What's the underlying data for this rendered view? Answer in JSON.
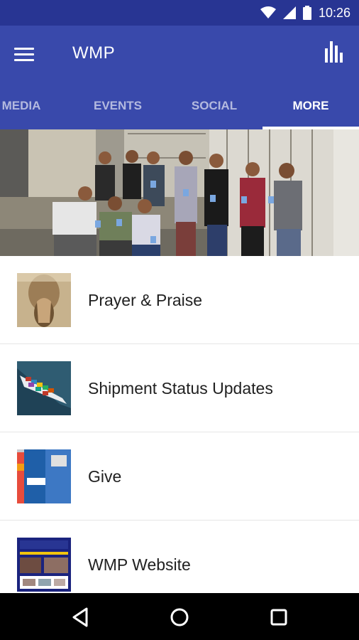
{
  "status_bar": {
    "time": "10:26",
    "icons": [
      "wifi-icon",
      "signal-icon",
      "battery-icon"
    ]
  },
  "app_bar": {
    "title": "WMP",
    "color": "#3949ab",
    "status_color": "#283593"
  },
  "tabs": [
    {
      "label": "MEDIA",
      "active": false
    },
    {
      "label": "EVENTS",
      "active": false
    },
    {
      "label": "SOCIAL",
      "active": false
    },
    {
      "label": "MORE",
      "active": true
    }
  ],
  "list": [
    {
      "label": "Prayer & Praise",
      "icon": "praying-hands-thumbnail"
    },
    {
      "label": "Shipment Status Updates",
      "icon": "cargo-ship-thumbnail"
    },
    {
      "label": "Give",
      "icon": "credit-card-thumbnail"
    },
    {
      "label": "WMP Website",
      "icon": "website-thumbnail"
    }
  ],
  "nav_bar": {
    "icons": [
      "back-icon",
      "home-icon",
      "recents-icon"
    ]
  }
}
